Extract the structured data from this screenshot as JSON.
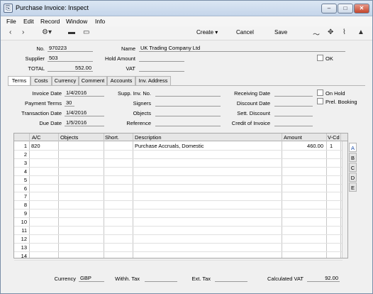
{
  "window": {
    "title": "Purchase Invoice: Inspect"
  },
  "menu": [
    "File",
    "Edit",
    "Record",
    "Window",
    "Info"
  ],
  "toolbar": {
    "create": "Create",
    "cancel": "Cancel",
    "save": "Save"
  },
  "header": {
    "no_label": "No.",
    "no": "970223",
    "name_label": "Name",
    "name": "UK Trading Company Ltd",
    "supplier_label": "Supplier",
    "supplier": "503",
    "hold_label": "Hold Amount",
    "hold": "",
    "ok_label": "OK",
    "total_label": "TOTAL",
    "total": "552.00",
    "vat_label": "VAT",
    "vat": ""
  },
  "tabs": [
    "Terms",
    "Costs",
    "Currency",
    "Comment",
    "Accounts",
    "Inv. Address"
  ],
  "terms": {
    "invoice_date_label": "Invoice Date",
    "invoice_date": "1/4/2016",
    "payment_terms_label": "Payment Terms",
    "payment_terms": "30",
    "transaction_date_label": "Transaction Date",
    "transaction_date": "1/4/2016",
    "due_date_label": "Due Date",
    "due_date": "1/5/2016",
    "supp_inv_label": "Supp. Inv. No.",
    "signers_label": "Signers",
    "objects_label": "Objects",
    "reference_label": "Reference",
    "receiving_date_label": "Receiving Date",
    "discount_date_label": "Discount Date",
    "sett_discount_label": "Sett. Discount",
    "credit_invoice_label": "Credit of Invoice",
    "on_hold_label": "On Hold",
    "prel_booking_label": "Prel. Booking"
  },
  "grid": {
    "columns": [
      "A/C",
      "Objects",
      "Short.",
      "Description",
      "Amount",
      "V-Cd"
    ],
    "rows": [
      {
        "n": "1",
        "ac": "820",
        "objects": "",
        "short": "",
        "description": "Purchase Accruals, Domestic",
        "amount": "460.00",
        "vcd": "1"
      },
      {
        "n": "2"
      },
      {
        "n": "3"
      },
      {
        "n": "4"
      },
      {
        "n": "5"
      },
      {
        "n": "6"
      },
      {
        "n": "7"
      },
      {
        "n": "8"
      },
      {
        "n": "9"
      },
      {
        "n": "10"
      },
      {
        "n": "11"
      },
      {
        "n": "12"
      },
      {
        "n": "13"
      },
      {
        "n": "14"
      }
    ],
    "side_tabs": [
      "A",
      "B",
      "C",
      "D",
      "E"
    ]
  },
  "footer": {
    "currency_label": "Currency",
    "currency": "GBP",
    "withh_tax_label": "Withh. Tax",
    "withh_tax": "",
    "ext_tax_label": "Ext. Tax",
    "ext_tax": "",
    "calc_vat_label": "Calculated VAT",
    "calc_vat": "92.00"
  }
}
